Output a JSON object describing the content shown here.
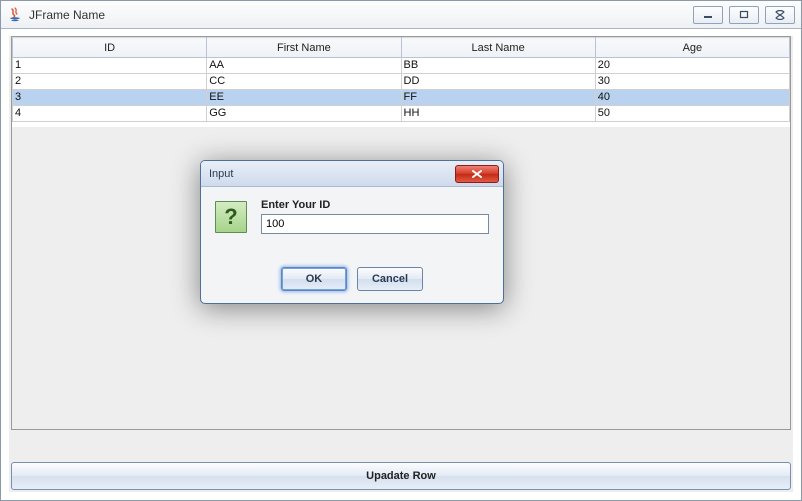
{
  "window": {
    "title": "JFrame Name",
    "min_tooltip": "Minimize",
    "max_tooltip": "Maximize",
    "close_tooltip": "Close"
  },
  "table": {
    "columns": [
      "ID",
      "First Name",
      "Last Name",
      "Age"
    ],
    "rows": [
      {
        "cells": [
          "1",
          "AA",
          "BB",
          "20"
        ],
        "selected": false
      },
      {
        "cells": [
          "2",
          "CC",
          "DD",
          "30"
        ],
        "selected": false
      },
      {
        "cells": [
          "3",
          "EE",
          "FF",
          "40"
        ],
        "selected": true
      },
      {
        "cells": [
          "4",
          "GG",
          "HH",
          "50"
        ],
        "selected": false
      }
    ]
  },
  "bottom_button": {
    "label": "Upadate Row"
  },
  "dialog": {
    "title": "Input",
    "prompt": "Enter Your ID",
    "value": "100",
    "ok_label": "OK",
    "cancel_label": "Cancel"
  }
}
